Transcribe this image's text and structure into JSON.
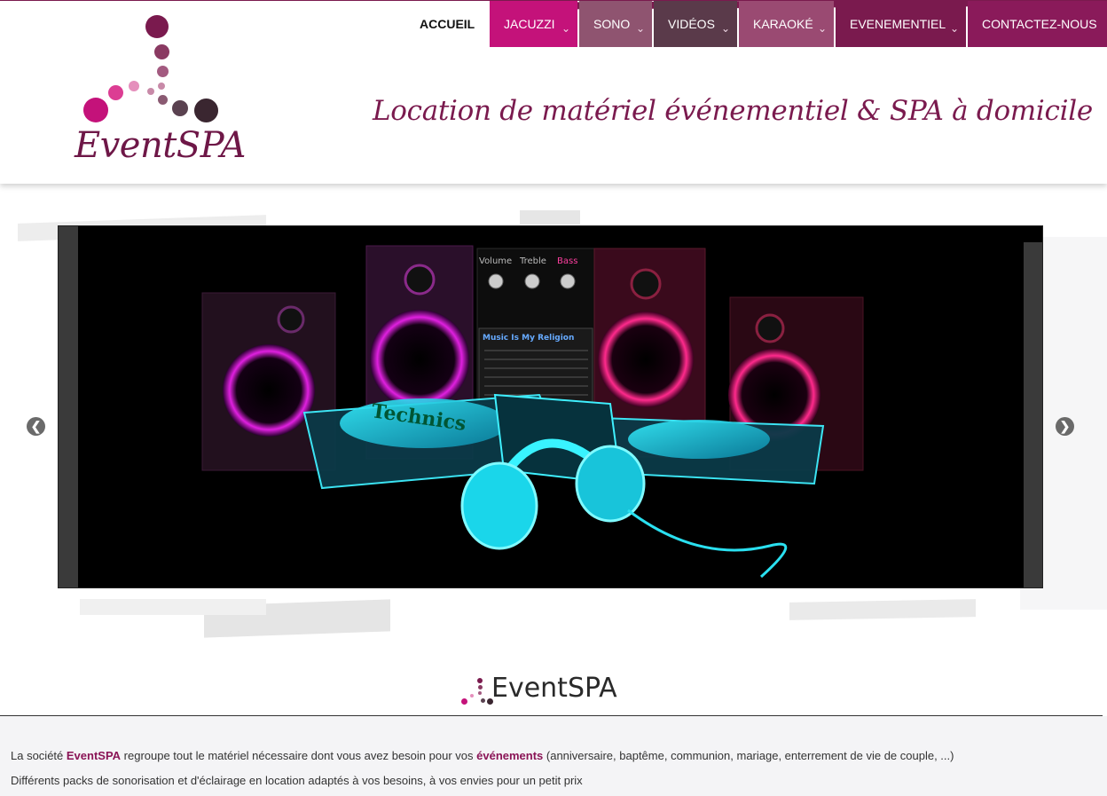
{
  "brand": {
    "logo_text": "EventSPA",
    "tagline": "Location de matériel événementiel & SPA à domicile",
    "colors": {
      "primary": "#7a1a4e",
      "pink": "#c4127a",
      "dark": "#3a2630"
    }
  },
  "nav": {
    "items": [
      {
        "label": "ACCUEIL",
        "active": true
      },
      {
        "label": "JACUZZI",
        "has_dropdown": true,
        "color": "#c4127a"
      },
      {
        "label": "SONO",
        "has_dropdown": true,
        "color": "#8f5470"
      },
      {
        "label": "VIDÉOS",
        "has_dropdown": true,
        "color": "#5a3a4a"
      },
      {
        "label": "KARAOKÉ",
        "has_dropdown": true,
        "color": "#9a4a72"
      },
      {
        "label": "EVENEMENTIEL",
        "has_dropdown": true,
        "color": "#7a1a4e"
      },
      {
        "label": "CONTACTEZ-NOUS",
        "color": "#8a1a5a"
      }
    ],
    "dropdown_icon": "chevron-down-icon"
  },
  "slider": {
    "prev_label": "❮",
    "next_label": "❯",
    "image": {
      "knob_labels": [
        "Volume",
        "Treble",
        "Bass"
      ],
      "screen_text": "Music Is My Religion",
      "turntable_text": "Technics"
    }
  },
  "content": {
    "title": "EventSPA",
    "paragraph1": {
      "pre": "La société ",
      "brand": "EventSPA",
      "mid": " regroupe tout le matériel nécessaire dont vous avez besoin pour vos ",
      "highlight": "événements",
      "post": " (anniversaire, baptême, communion, mariage, enterrement de vie de couple, ...)"
    },
    "paragraph2": "Différents packs de sonorisation et d'éclairage en location adaptés à vos besoins, à vos envies pour un petit prix"
  }
}
